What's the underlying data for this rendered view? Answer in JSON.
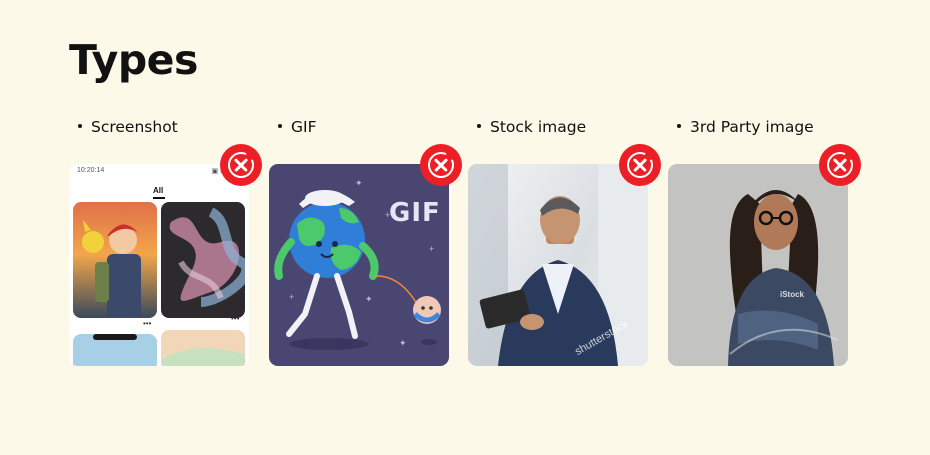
{
  "page": {
    "title": "Types"
  },
  "types": [
    {
      "label": "Screenshot",
      "thumb": "screenshot-thumbnail"
    },
    {
      "label": "GIF",
      "thumb": "gif-thumbnail"
    },
    {
      "label": "Stock image",
      "thumb": "stock-image-thumbnail"
    },
    {
      "label": "3rd Party image",
      "thumb": "third-party-image-thumbnail"
    }
  ],
  "screenshot": {
    "time": "10:20:14",
    "tab": "All"
  },
  "gif": {
    "overlay": "GIF"
  },
  "stock": {
    "watermark": "shutterstock"
  },
  "third": {
    "watermark": "iStock"
  },
  "badge_icon": "rejected-x-icon",
  "colors": {
    "background": "#fdf9e8",
    "badge": "#ec1f26"
  }
}
